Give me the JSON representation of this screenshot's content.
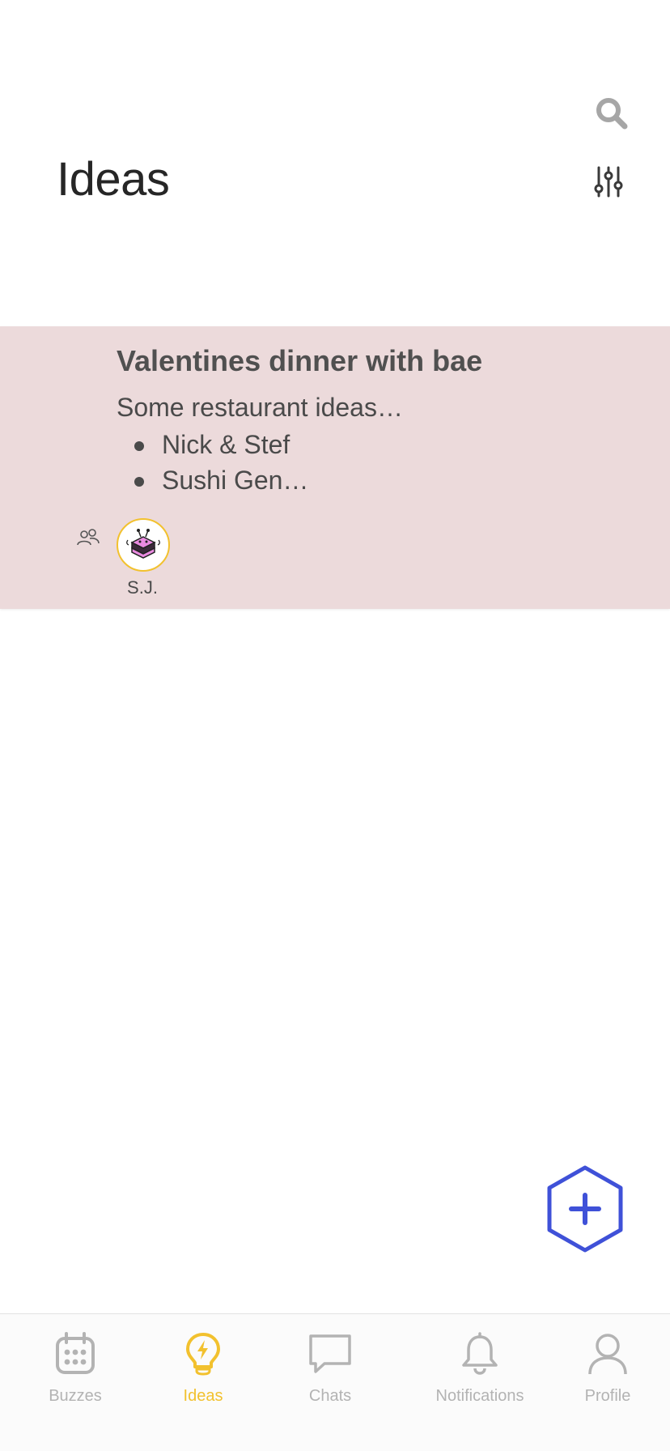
{
  "header": {
    "title": "Ideas",
    "search_icon": "search-icon",
    "filter_icon": "sliders-icon"
  },
  "ideas": [
    {
      "title": "Valentines dinner with bae",
      "intro": "Some restaurant ideas…",
      "bullets": [
        "Nick & Stef",
        "Sushi Gen…"
      ],
      "shared_icon": "people-icon",
      "author_initials": "S.J.",
      "avatar_icon": "bee-cake-avatar"
    }
  ],
  "fab": {
    "icon": "plus-icon",
    "color": "#3f51d8"
  },
  "tabs": [
    {
      "label": "Buzzes",
      "icon": "calendar-icon",
      "active": false
    },
    {
      "label": "Ideas",
      "icon": "lightbulb-icon",
      "active": true
    },
    {
      "label": "Chats",
      "icon": "chat-bubble-icon",
      "active": false
    },
    {
      "label": "Notifications",
      "icon": "bell-icon",
      "active": false
    },
    {
      "label": "Profile",
      "icon": "person-icon",
      "active": false
    }
  ],
  "colors": {
    "accent": "#f2c12e",
    "card_bg": "#ecdadb",
    "inactive": "#b3b3b3"
  }
}
